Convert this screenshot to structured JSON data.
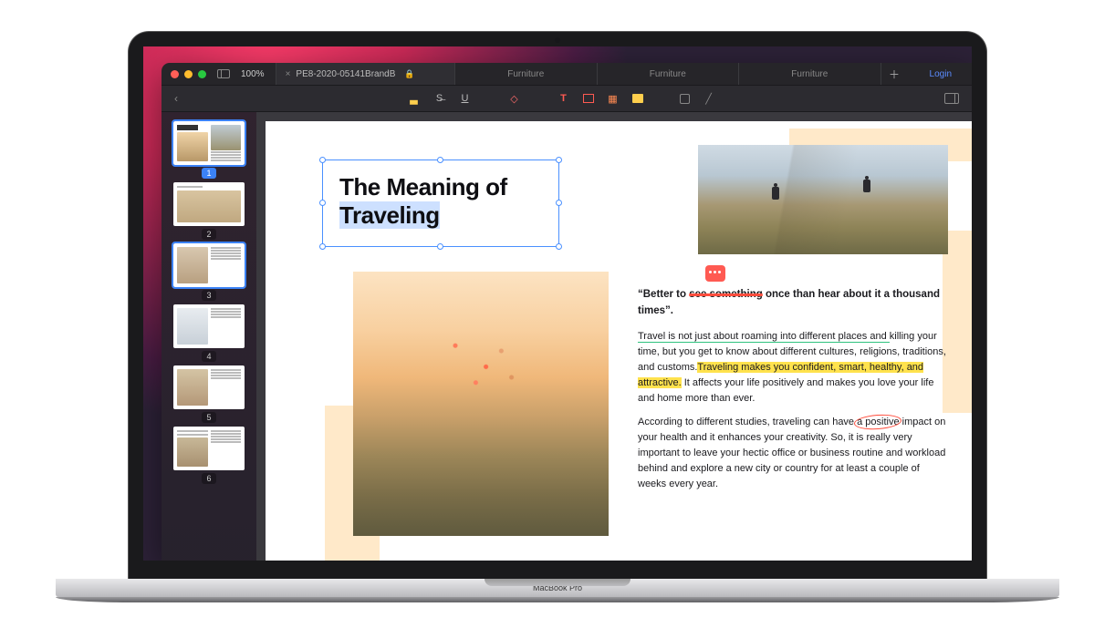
{
  "device_label": "MacBook Pro",
  "window": {
    "zoom": "100%",
    "login_label": "Login"
  },
  "tabs": [
    {
      "label": "PE8-2020-05141BrandB",
      "locked": true,
      "active": true
    },
    {
      "label": "Furniture"
    },
    {
      "label": "Furniture"
    },
    {
      "label": "Furniture"
    }
  ],
  "toolbar": {
    "back_icon": "chevron-left",
    "tools_draw": [
      "highlighter",
      "strike",
      "underline"
    ],
    "tools_erase": [
      "eraser"
    ],
    "tools_annotate": [
      "text",
      "textbox",
      "stamp",
      "note"
    ],
    "tools_shape": [
      "shape",
      "line"
    ],
    "view_icon": "panel-right"
  },
  "thumbnails": [
    {
      "n": 1,
      "selected": true
    },
    {
      "n": 2,
      "selected": false
    },
    {
      "n": 3,
      "selected": true
    },
    {
      "n": 4,
      "selected": false
    },
    {
      "n": 5,
      "selected": false
    },
    {
      "n": 6,
      "selected": false
    }
  ],
  "document": {
    "title_line1": "The Meaning of",
    "title_line2": "Traveling",
    "quote_pre": "“Better to ",
    "quote_strike": "see something",
    "quote_post": " once than hear about it a thousand times”.",
    "p1_ul": "Travel is not just about roaming into different places and ",
    "p1_mid": "killing your time, but you get to know about different cultures, religions, traditions, and customs.",
    "p1_hl": "Traveling makes you confident, smart, healthy, and attractive.",
    "p1_end": " It affects your life positively and makes you love your life and home more than ever.",
    "p2_pre": "According to different studies, traveling can have ",
    "p2_circled": "a positive",
    "p2_post": " impact on your health and it enhances your creativity. So, it is really very important to leave your hectic office or business routine and workload behind and explore a new city or country for at least a couple of weeks every year."
  }
}
